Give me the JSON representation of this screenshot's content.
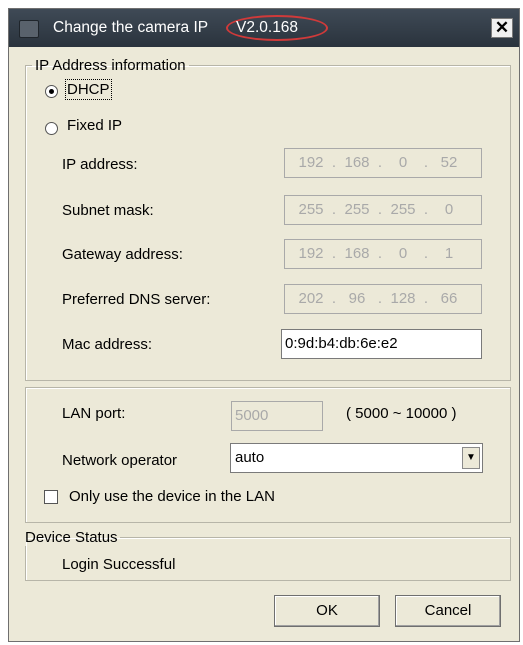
{
  "window": {
    "title": "Change the camera IP",
    "version": "V2.0.168",
    "close_label": "✕"
  },
  "ip_group": {
    "legend": "IP Address information",
    "dhcp_label": "DHCP",
    "dhcp_selected": true,
    "fixed_label": "Fixed IP",
    "ip_label": "IP address:",
    "ip_octets": [
      "192",
      "168",
      "0",
      "52"
    ],
    "mask_label": "Subnet mask:",
    "mask_octets": [
      "255",
      "255",
      "255",
      "0"
    ],
    "gateway_label": "Gateway address:",
    "gateway_octets": [
      "192",
      "168",
      "0",
      "1"
    ],
    "dns_label": "Preferred DNS server:",
    "dns_octets": [
      "202",
      "96",
      "128",
      "66"
    ],
    "mac_label": "Mac address:",
    "mac_value": "0:9d:b4:db:6e:e2"
  },
  "network_group": {
    "lan_port_label": "LAN port:",
    "lan_port_value": "5000",
    "port_range": "( 5000 ~ 10000 )",
    "operator_label": "Network operator",
    "operator_value": "auto",
    "lan_only_label": "Only use the device in the LAN",
    "lan_only_checked": false
  },
  "status_group": {
    "legend": "Device Status",
    "status_text": "Login Successful"
  },
  "buttons": {
    "ok": "OK",
    "cancel": "Cancel"
  },
  "colors": {
    "title_bar": "#2f3842",
    "dialog_bg": "#ece9d8",
    "version_highlight": "#d03a3a"
  }
}
